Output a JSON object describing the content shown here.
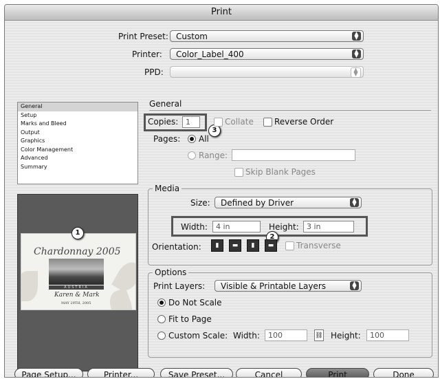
{
  "window": {
    "title": "Print"
  },
  "top": {
    "preset_label": "Print Preset:",
    "preset_value": "Custom",
    "printer_label": "Printer:",
    "printer_value": "Color_Label_400",
    "ppd_label": "PPD:",
    "ppd_value": ""
  },
  "sidebar": {
    "items": [
      {
        "label": "General",
        "selected": true
      },
      {
        "label": "Setup"
      },
      {
        "label": "Marks and Bleed"
      },
      {
        "label": "Output"
      },
      {
        "label": "Graphics"
      },
      {
        "label": "Color Management"
      },
      {
        "label": "Advanced"
      },
      {
        "label": "Summary"
      }
    ]
  },
  "preview": {
    "title": "Chardonnay 2005",
    "band": "AUSTRIA",
    "names": "Karen & Mark",
    "date": "MAY 29TH, 2005",
    "badge": "1"
  },
  "general": {
    "heading": "General",
    "copies_label": "Copies:",
    "copies_value": "1",
    "collate_label": "Collate",
    "reverse_label": "Reverse Order",
    "pages_label": "Pages:",
    "all_label": "All",
    "range_label": "Range:",
    "range_value": "",
    "skip_label": "Skip Blank Pages",
    "badge": "3"
  },
  "media": {
    "heading": "Media",
    "size_label": "Size:",
    "size_value": "Defined by Driver",
    "width_label": "Width:",
    "width_value": "4 in",
    "height_label": "Height:",
    "height_value": "3 in",
    "orientation_label": "Orientation:",
    "transverse_label": "Transverse",
    "badge": "2"
  },
  "options": {
    "heading": "Options",
    "layers_label": "Print Layers:",
    "layers_value": "Visible & Printable Layers",
    "no_scale_label": "Do Not Scale",
    "fit_label": "Fit to Page",
    "custom_label": "Custom Scale:",
    "scale_width_label": "Width:",
    "scale_width_value": "100",
    "scale_height_label": "Height:",
    "scale_height_value": "100"
  },
  "buttons": {
    "page_setup": "Page Setup...",
    "printer": "Printer...",
    "save_preset": "Save Preset...",
    "cancel": "Cancel",
    "print": "Print",
    "done": "Done"
  },
  "icons": {
    "popup_arrows": "up-down-arrows-icon",
    "chain": "chain-link-icon",
    "orientation": [
      "portrait-icon",
      "landscape-icon",
      "reverse-portrait-icon",
      "reverse-landscape-icon"
    ]
  }
}
